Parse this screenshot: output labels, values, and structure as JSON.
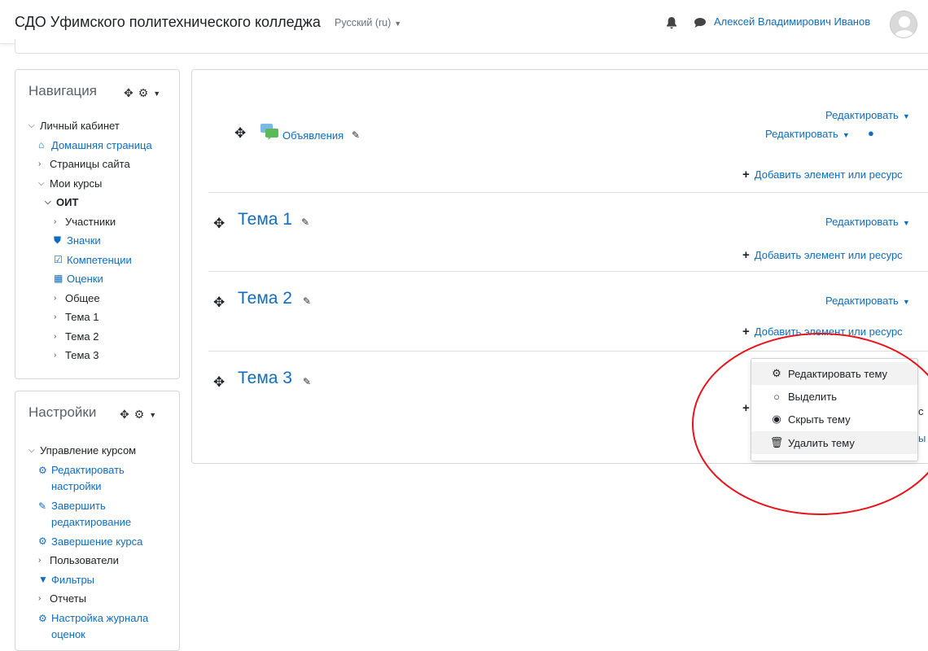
{
  "header": {
    "site_name": "СДО Уфимского политехнического колледжа",
    "language": "Русский (ru)",
    "user_name": "Алексей Владимирович Иванов"
  },
  "navigation_block": {
    "title": "Навигация",
    "items": [
      {
        "label": "Личный кабинет",
        "icon": "chevron-down"
      },
      {
        "label": "Домашняя страница",
        "icon": "home-icon"
      },
      {
        "label": "Страницы сайта",
        "icon": "chevron-right"
      },
      {
        "label": "Мои курсы",
        "icon": "chevron-down"
      },
      {
        "label": "ОИТ",
        "icon": "chevron-down"
      },
      {
        "label": "Участники",
        "icon": "chevron-right"
      },
      {
        "label": "Значки",
        "icon": "shield-icon"
      },
      {
        "label": "Компетенции",
        "icon": "checkbox-icon"
      },
      {
        "label": "Оценки",
        "icon": "table-icon"
      },
      {
        "label": "Общее",
        "icon": "chevron-right"
      },
      {
        "label": "Тема 1",
        "icon": "chevron-right"
      },
      {
        "label": "Тема 2",
        "icon": "chevron-right"
      },
      {
        "label": "Тема 3",
        "icon": "chevron-right"
      }
    ]
  },
  "settings_block": {
    "title": "Настройки",
    "items": [
      {
        "label": "Управление курсом",
        "icon": "chevron-down"
      },
      {
        "label": "Редактировать настройки",
        "icon": "gear-icon"
      },
      {
        "label": "Завершить редактирование",
        "icon": "pencil-icon"
      },
      {
        "label": "Завершение курса",
        "icon": "gear-icon"
      },
      {
        "label": "Пользователи",
        "icon": "chevron-right"
      },
      {
        "label": "Фильтры",
        "icon": "filter-icon"
      },
      {
        "label": "Отчеты",
        "icon": "chevron-right"
      },
      {
        "label": "Настройка журнала оценок",
        "icon": "gear-icon"
      }
    ]
  },
  "course": {
    "general": {
      "edit_label": "Редактировать",
      "activity": {
        "name": "Объявления",
        "edit_label": "Редактировать",
        "icon": "forum-icon"
      },
      "add_label": "Добавить элемент или ресурс"
    },
    "sections": [
      {
        "title": "Тема 1",
        "edit_label": "Редактировать",
        "add_label": "Добавить элемент или ресурс"
      },
      {
        "title": "Тема 2",
        "edit_label": "Редактировать",
        "add_label": "Добавить элемент или ресурс"
      },
      {
        "title": "Тема 3"
      }
    ]
  },
  "section_menu": {
    "items": [
      {
        "label": "Редактировать тему",
        "icon": "gear-icon"
      },
      {
        "label": "Выделить",
        "icon": "circle-icon"
      },
      {
        "label": "Скрыть тему",
        "icon": "eye-icon"
      },
      {
        "label": "Удалить тему",
        "icon": "trash-icon"
      }
    ],
    "highlighted": [
      "Редактировать тему",
      "Удалить тему"
    ]
  },
  "colors": {
    "link": "#0f6cbf",
    "annotation": "#e8141b",
    "border": "#d6d6d6"
  }
}
